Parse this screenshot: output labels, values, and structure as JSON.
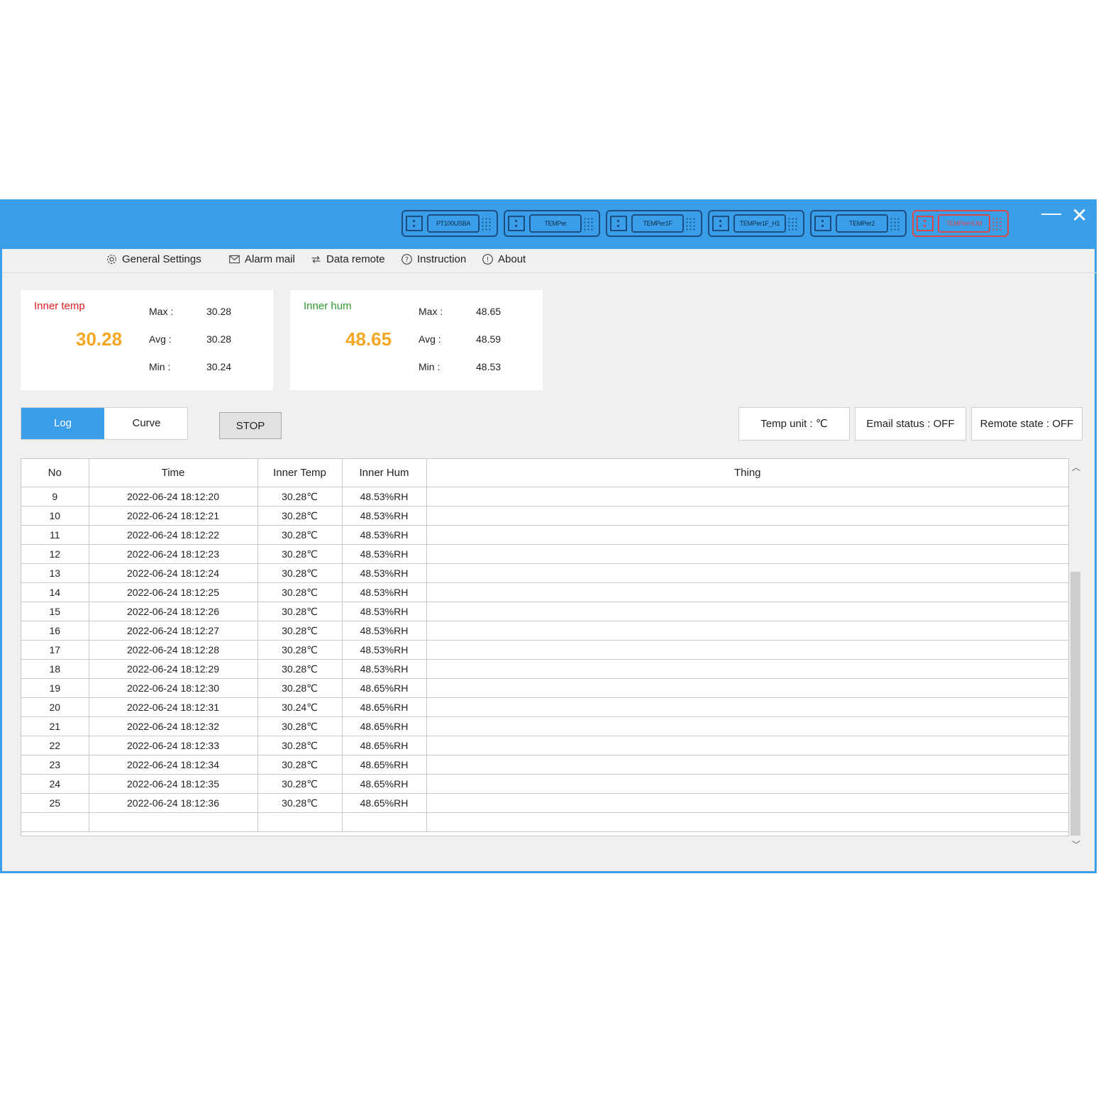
{
  "titlebar": {
    "devices": [
      {
        "label": "PT100USBA",
        "state": "normal"
      },
      {
        "label": "TEMPer",
        "state": "normal"
      },
      {
        "label": "TEMPer1F",
        "state": "normal"
      },
      {
        "label": "TEMPer1F_H1",
        "state": "normal"
      },
      {
        "label": "TEMPer2",
        "state": "normal"
      },
      {
        "label": "TEMPerHUM",
        "state": "active-red"
      }
    ],
    "minimize_icon": "minimize-icon",
    "close_icon": "close-icon"
  },
  "menu": [
    {
      "label": "General Settings",
      "icon": "gear-icon"
    },
    {
      "label": "Alarm mail",
      "icon": "mail-icon"
    },
    {
      "label": "Data remote",
      "icon": "remote-icon"
    },
    {
      "label": "Instruction",
      "icon": "question-icon"
    },
    {
      "label": "About",
      "icon": "info-icon"
    }
  ],
  "temp_card": {
    "title": "Inner temp",
    "current": "30.28",
    "max_label": "Max :",
    "max": "30.28",
    "avg_label": "Avg :",
    "avg": "30.28",
    "min_label": "Min :",
    "min": "30.24",
    "title_color": "#e02020"
  },
  "hum_card": {
    "title": "Inner hum",
    "current": "48.65",
    "max_label": "Max :",
    "max": "48.65",
    "avg_label": "Avg :",
    "avg": "48.59",
    "min_label": "Min :",
    "min": "48.53",
    "title_color": "#2e9a2e"
  },
  "tabs": {
    "log": "Log",
    "curve": "Curve",
    "active": "Log"
  },
  "stop_label": "STOP",
  "status": {
    "temp_unit": "Temp unit : ℃",
    "email": "Email status : OFF",
    "remote": "Remote state : OFF"
  },
  "table": {
    "headers": [
      "No",
      "Time",
      "Inner Temp",
      "Inner Hum",
      "Thing"
    ],
    "rows": [
      [
        "9",
        "2022-06-24 18:12:20",
        "30.28℃",
        "48.53%RH",
        ""
      ],
      [
        "10",
        "2022-06-24 18:12:21",
        "30.28℃",
        "48.53%RH",
        ""
      ],
      [
        "11",
        "2022-06-24 18:12:22",
        "30.28℃",
        "48.53%RH",
        ""
      ],
      [
        "12",
        "2022-06-24 18:12:23",
        "30.28℃",
        "48.53%RH",
        ""
      ],
      [
        "13",
        "2022-06-24 18:12:24",
        "30.28℃",
        "48.53%RH",
        ""
      ],
      [
        "14",
        "2022-06-24 18:12:25",
        "30.28℃",
        "48.53%RH",
        ""
      ],
      [
        "15",
        "2022-06-24 18:12:26",
        "30.28℃",
        "48.53%RH",
        ""
      ],
      [
        "16",
        "2022-06-24 18:12:27",
        "30.28℃",
        "48.53%RH",
        ""
      ],
      [
        "17",
        "2022-06-24 18:12:28",
        "30.28℃",
        "48.53%RH",
        ""
      ],
      [
        "18",
        "2022-06-24 18:12:29",
        "30.28℃",
        "48.53%RH",
        ""
      ],
      [
        "19",
        "2022-06-24 18:12:30",
        "30.28℃",
        "48.65%RH",
        ""
      ],
      [
        "20",
        "2022-06-24 18:12:31",
        "30.24℃",
        "48.65%RH",
        ""
      ],
      [
        "21",
        "2022-06-24 18:12:32",
        "30.28℃",
        "48.65%RH",
        ""
      ],
      [
        "22",
        "2022-06-24 18:12:33",
        "30.28℃",
        "48.65%RH",
        ""
      ],
      [
        "23",
        "2022-06-24 18:12:34",
        "30.28℃",
        "48.65%RH",
        ""
      ],
      [
        "24",
        "2022-06-24 18:12:35",
        "30.28℃",
        "48.65%RH",
        ""
      ],
      [
        "25",
        "2022-06-24 18:12:36",
        "30.28℃",
        "48.65%RH",
        ""
      ],
      [
        "",
        "",
        "",
        "",
        ""
      ]
    ]
  },
  "colors": {
    "accent": "#3b9ee8",
    "value": "#f5a623"
  }
}
